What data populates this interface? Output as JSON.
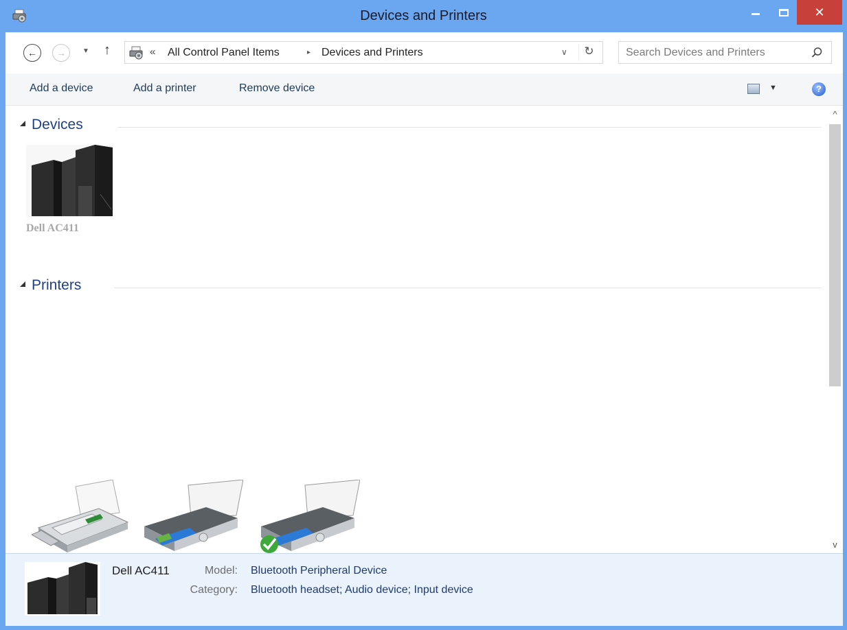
{
  "window": {
    "title": "Devices and Printers",
    "minimize_label": "",
    "close_label": "✕"
  },
  "navigation": {
    "back_glyph": "←",
    "forward_glyph": "→",
    "recent_glyph": "▼",
    "up_glyph": "↑",
    "breadcrumb_chevron": "«",
    "breadcrumbs": [
      "All Control Panel Items",
      "Devices and Printers"
    ],
    "breadcrumb_separator": "▸",
    "address_dropdown_glyph": "∨",
    "refresh_glyph": "↻",
    "search_placeholder": "Search Devices and Printers"
  },
  "toolbar": {
    "add_device": "Add a device",
    "add_printer": "Add a printer",
    "remove_device": "Remove device",
    "view_dropdown_glyph": "▼",
    "help_glyph": "?"
  },
  "groups": {
    "devices": {
      "label": "Devices",
      "items": [
        {
          "name": "Dell AC411",
          "icon": "speaker-icon"
        }
      ]
    },
    "printers": {
      "label": "Printers",
      "items": [
        {
          "icon": "fax-icon"
        },
        {
          "icon": "printer-icon"
        },
        {
          "icon": "default-printer-icon",
          "default": true
        }
      ]
    }
  },
  "scrollbar": {
    "up_glyph": "^",
    "down_glyph": "v"
  },
  "details": {
    "name": "Dell AC411",
    "model_key": "Model:",
    "model_value": "Bluetooth Peripheral Device",
    "category_key": "Category:",
    "category_value": "Bluetooth headset; Audio device; Input device"
  },
  "colors": {
    "frame": "#6aa7f0",
    "close": "#c7413a",
    "group_heading": "#1e3f8a",
    "details_bg": "#eaf2fc"
  }
}
